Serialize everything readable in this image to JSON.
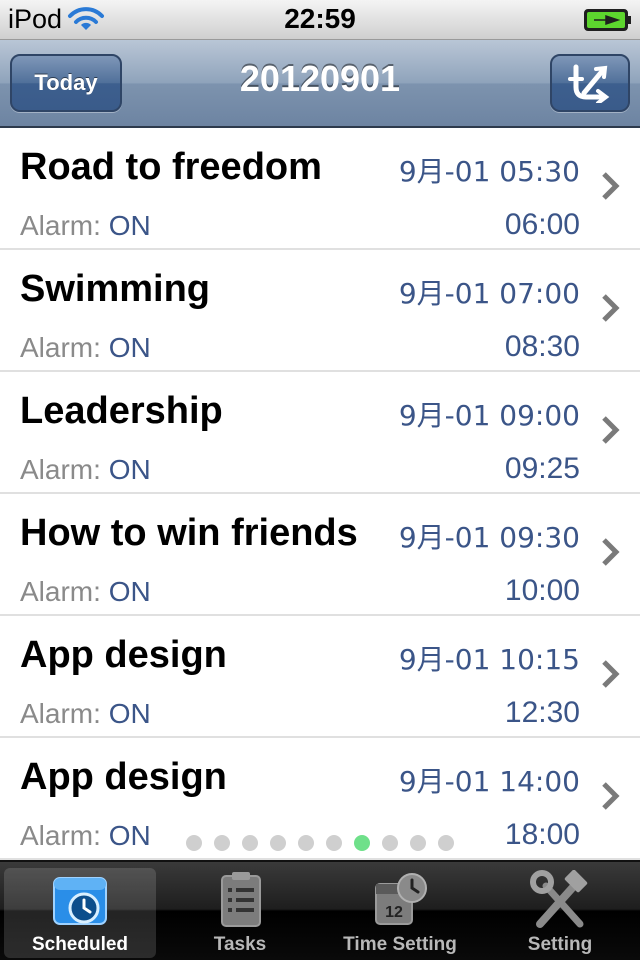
{
  "status_bar": {
    "carrier": "iPod",
    "time": "22:59"
  },
  "nav": {
    "today_label": "Today",
    "title": "20120901"
  },
  "schedule": [
    {
      "title": "Road to freedom",
      "start": "9月-01 05:30",
      "alarm_label": "Alarm:",
      "alarm_value": "ON",
      "end": "06:00"
    },
    {
      "title": "Swimming",
      "start": "9月-01 07:00",
      "alarm_label": "Alarm:",
      "alarm_value": "ON",
      "end": "08:30"
    },
    {
      "title": "Leadership",
      "start": "9月-01 09:00",
      "alarm_label": "Alarm:",
      "alarm_value": "ON",
      "end": "09:25"
    },
    {
      "title": "How to win friends",
      "start": "9月-01 09:30",
      "alarm_label": "Alarm:",
      "alarm_value": "ON",
      "end": "10:00"
    },
    {
      "title": "App design",
      "start": "9月-01 10:15",
      "alarm_label": "Alarm:",
      "alarm_value": "ON",
      "end": "12:30"
    },
    {
      "title": "App design",
      "start": "9月-01 14:00",
      "alarm_label": "Alarm:",
      "alarm_value": "ON",
      "end": "18:00"
    }
  ],
  "page_indicator": {
    "total": 10,
    "current": 7,
    "active_color": "#6fe08a"
  },
  "tabs": [
    {
      "label": "Scheduled",
      "icon": "clock-calendar-icon",
      "active": true
    },
    {
      "label": "Tasks",
      "icon": "clipboard-list-icon",
      "active": false
    },
    {
      "label": "Time Setting",
      "icon": "calendar-clock-icon",
      "active": false
    },
    {
      "label": "Setting",
      "icon": "hammer-wrench-icon",
      "active": false
    }
  ],
  "colors": {
    "accent_blue": "#3b5588",
    "nav_bar": "#8fa3bb"
  }
}
